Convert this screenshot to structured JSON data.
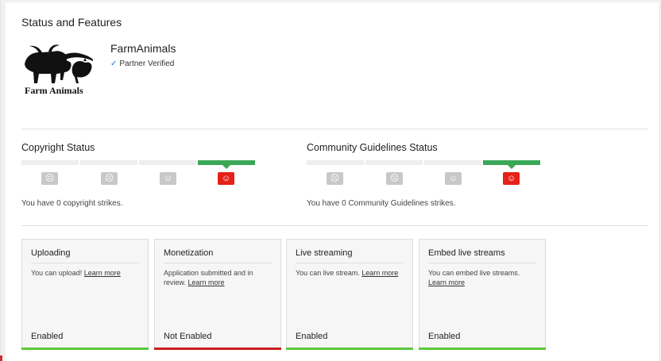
{
  "page": {
    "title": "Status and Features"
  },
  "channel": {
    "logo_text": "Farm Animals",
    "name": "FarmAnimals",
    "verified_label": "Partner Verified"
  },
  "copyright": {
    "title": "Copyright Status",
    "strike_text": "You have 0 copyright strikes."
  },
  "community": {
    "title": "Community Guidelines Status",
    "strike_text": "You have 0 Community Guidelines strikes."
  },
  "cards": [
    {
      "title": "Uploading",
      "desc": "You can upload!",
      "link": "Learn more",
      "status": "Enabled",
      "enabled": true
    },
    {
      "title": "Monetization",
      "desc": "Application submitted and in review.",
      "link": "Learn more",
      "status": "Not Enabled",
      "enabled": false
    },
    {
      "title": "Live streaming",
      "desc": "You can live stream.",
      "link": "Learn more",
      "status": "Enabled",
      "enabled": true
    },
    {
      "title": "Embed live streams",
      "desc": "You can embed live streams.",
      "link": "Learn more",
      "status": "Enabled",
      "enabled": true
    }
  ],
  "colors": {
    "enabled": "#5ac83c",
    "not_enabled": "#cc1f1f",
    "status_good": "#3aa757",
    "face_active": "#e62117"
  }
}
